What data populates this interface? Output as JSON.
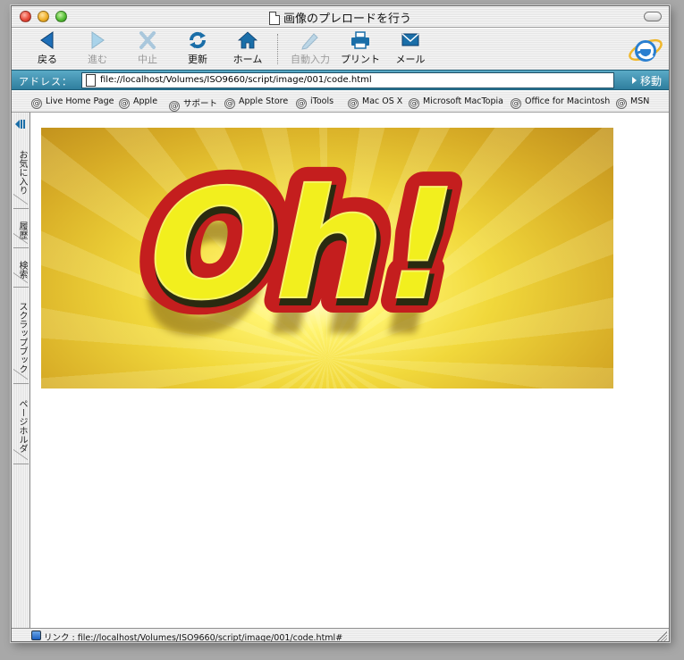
{
  "window": {
    "title": "画像のプレロードを行う"
  },
  "toolbar": {
    "back": "戻る",
    "forward": "進む",
    "stop": "中止",
    "refresh": "更新",
    "home": "ホーム",
    "autofill": "自動入力",
    "print": "プリント",
    "mail": "メール"
  },
  "address": {
    "label": "アドレス：",
    "url": "file://localhost/Volumes/ISO9660/script/image/001/code.html",
    "go": "移動"
  },
  "favorites": [
    "Live Home Page",
    "Apple",
    "サポート",
    "Apple Store",
    "iTools",
    "Mac OS X",
    "Microsoft MacTopia",
    "Office for Macintosh",
    "MSN"
  ],
  "sidebar": {
    "tabs": [
      "お気に入り",
      "履歴",
      "検索",
      "スクラップブック",
      "ページホルダ"
    ]
  },
  "banner": {
    "text": "Oh!"
  },
  "status": {
    "text": "リンク : file://localhost/Volumes/ISO9660/script/image/001/code.html#"
  },
  "colors": {
    "address_bar": "#3b8fb0",
    "banner_red": "#c41e1e",
    "banner_yellow": "#f2ef1e"
  }
}
